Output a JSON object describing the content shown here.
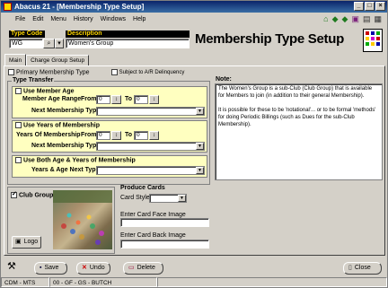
{
  "window": {
    "title": "Abacus 21 - [Membership Type Setup]"
  },
  "menu": [
    "File",
    "Edit",
    "Menu",
    "History",
    "Windows",
    "Help"
  ],
  "nav_icons": [
    "home-icon",
    "next-icon",
    "prev-icon",
    "notebook-icon",
    "print-icon",
    "grid-icon"
  ],
  "header": {
    "type_code_label": "Type Code",
    "type_code_value": "WG",
    "description_label": "Description",
    "description_value": "Women's Group",
    "page_title": "Membership Type Setup"
  },
  "tabs": [
    "Main",
    "Charge Group Setup"
  ],
  "main": {
    "primary_membership_type": "Primary Membership Type",
    "subject_ar": "Subject to A/R Delinquency",
    "type_transfer": "Type Transfer",
    "use_member_age": "Use Member Age",
    "member_age_range": "Member Age Range",
    "from": "From",
    "to": "To",
    "age_from": "0",
    "age_to": "0",
    "next_membership_type": "Next Membership Type",
    "use_years": "Use Years of Membership",
    "years_of_membership": "Years Of Membership",
    "years_from": "0",
    "years_to": "0",
    "use_both": "Use Both Age & Years of Membership",
    "years_age_next_type": "Years & Age Next Type",
    "note_label": "Note:",
    "note_p1": "The Women's Group is a sub-Club (Club Group) that is available for Members to join (in addition to their general Membership).",
    "note_p2": "It is possible for these to be 'notational'... or to be formal 'methods' for doing Periodic Billings (such as Dues for the sub-Club Membership).",
    "club_group": "Club Group",
    "logo_button": "Logo",
    "produce_cards": "Produce Cards",
    "card_style": "Card Style",
    "card_front": "Enter Card Face Image",
    "card_back": "Enter Card Back Image"
  },
  "buttons": {
    "save": "Save",
    "undo": "Undo",
    "delete": "Delete",
    "close": "Close"
  },
  "status": [
    "CDM - MTS",
    "00 - GF - GS - BUTCH"
  ]
}
